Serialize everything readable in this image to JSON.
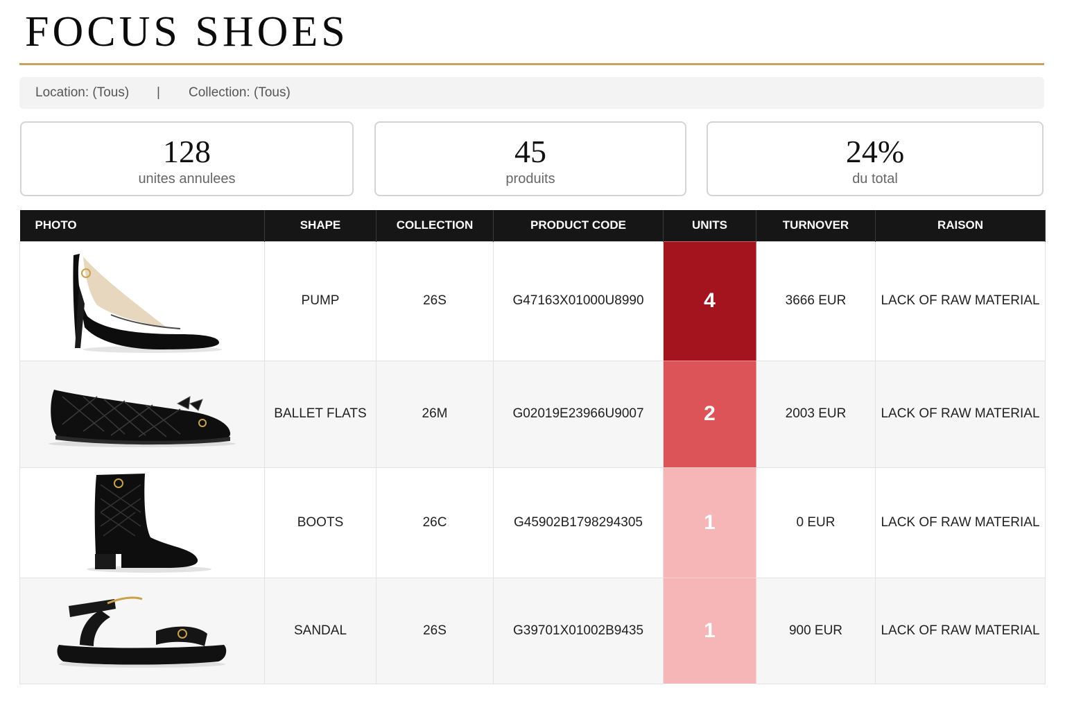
{
  "header": {
    "title": "FOCUS SHOES"
  },
  "filters": {
    "location": "Location: (Tous)",
    "separator": "|",
    "collection": "Collection: (Tous)"
  },
  "kpis": [
    {
      "value": "128",
      "label": "unites annulees"
    },
    {
      "value": "45",
      "label": "produits"
    },
    {
      "value": "24%",
      "label": "du total"
    }
  ],
  "table": {
    "columns": [
      "PHOTO",
      "SHAPE",
      "COLLECTION",
      "PRODUCT CODE",
      "UNITS",
      "TURNOVER",
      "RAISON"
    ],
    "rows": [
      {
        "photo": "pump-shoe-image",
        "shape": "PUMP",
        "collection": "26S",
        "code": "G47163X01000U8990",
        "units": "4",
        "turnover": "3666 EUR",
        "raison": "LACK OF RAW MATERIAL"
      },
      {
        "photo": "ballet-flat-image",
        "shape": "BALLET FLATS",
        "collection": "26M",
        "code": "G02019E23966U9007",
        "units": "2",
        "turnover": "2003 EUR",
        "raison": "LACK OF RAW MATERIAL"
      },
      {
        "photo": "ankle-boot-image",
        "shape": "BOOTS",
        "collection": "26C",
        "code": "G45902B1798294305",
        "units": "1",
        "turnover": "0 EUR",
        "raison": "LACK OF RAW MATERIAL"
      },
      {
        "photo": "sandal-image",
        "shape": "SANDAL",
        "collection": "26S",
        "code": "G39701X01002B9435",
        "units": "1",
        "turnover": "900 EUR",
        "raison": "LACK OF RAW MATERIAL"
      }
    ]
  },
  "colors": {
    "accent_gold": "#c4a35f",
    "header_bg": "#161616",
    "units_scale": {
      "4": "#a3141f",
      "2": "#dc5457",
      "1": "#f6b5b7"
    }
  }
}
